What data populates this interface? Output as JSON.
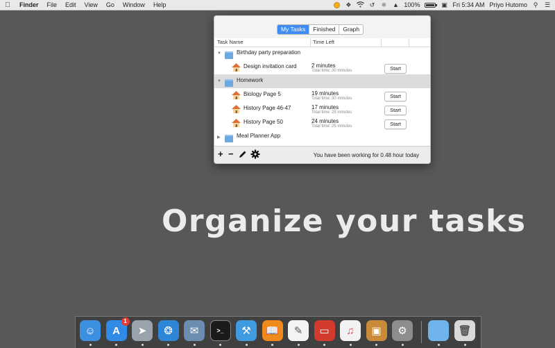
{
  "menubar": {
    "app_name": "Finder",
    "menus": [
      "File",
      "Edit",
      "View",
      "Go",
      "Window",
      "Help"
    ],
    "battery_percent": "100%",
    "battery_level": 1.0,
    "datetime": "Fri 5:34 AM",
    "user": "Priyo Hutomo",
    "tray_icons": [
      "task-timer-icon",
      "dropbox-icon",
      "wifi-icon",
      "time-machine-icon",
      "bluetooth-icon",
      "volume-icon",
      "battery-icon",
      "notification-center-icon",
      "spotlight-icon",
      "menu-list-icon"
    ]
  },
  "popover": {
    "tabs": [
      {
        "label": "My Tasks",
        "active": true
      },
      {
        "label": "Finished",
        "active": false
      },
      {
        "label": "Graph",
        "active": false
      }
    ],
    "columns": {
      "task_name": "Task Name",
      "time_left": "Time Left"
    },
    "rows": [
      {
        "type": "group",
        "name": "Birthday party preparation",
        "expanded": true
      },
      {
        "type": "task",
        "name": "Design invitation card",
        "time_left": "2 minutes",
        "total": "Total time: 30 minutes",
        "button": "Start"
      },
      {
        "type": "group",
        "name": "Homework",
        "expanded": true,
        "selected": true
      },
      {
        "type": "task",
        "name": "Biology Page 5",
        "time_left": "19 minutes",
        "total": "Total time: 30 minutes",
        "button": "Start"
      },
      {
        "type": "task",
        "name": "History Page 46-47",
        "time_left": "17 minutes",
        "total": "Total time: 25 minutes",
        "button": "Start"
      },
      {
        "type": "task",
        "name": "History Page 50",
        "time_left": "24 minutes",
        "total": "Total time: 25 minutes",
        "button": "Start"
      },
      {
        "type": "group",
        "name": "Meal Planner App",
        "expanded": false
      }
    ],
    "footer": {
      "add": "+",
      "remove": "−",
      "edit_icon": "pencil-icon",
      "settings_icon": "gear-icon",
      "status": "You have been working for 0.48 hour today"
    }
  },
  "headline": "Organize your tasks",
  "dock": {
    "apps": [
      {
        "name": "finder",
        "color": "#3d8fe0"
      },
      {
        "name": "app-store",
        "color": "#2f8be6",
        "badge": "1"
      },
      {
        "name": "launchpad",
        "color": "#9aa3ad"
      },
      {
        "name": "safari",
        "color": "#2e86d8"
      },
      {
        "name": "mail-stamp",
        "color": "#6c8db0"
      },
      {
        "name": "terminal",
        "color": "#1b1b1b"
      },
      {
        "name": "xcode",
        "color": "#3f9ae0"
      },
      {
        "name": "ibooks",
        "color": "#f08a1c"
      },
      {
        "name": "textedit",
        "color": "#f4f4f4"
      },
      {
        "name": "parallels",
        "color": "#d43b2f"
      },
      {
        "name": "itunes",
        "color": "#f2f2f2"
      },
      {
        "name": "preview",
        "color": "#c98b3a"
      },
      {
        "name": "system-preferences",
        "color": "#8d8d8d"
      },
      {
        "name": "downloads-folder",
        "color": "#6fb4ec"
      },
      {
        "name": "trash",
        "color": "#d9d9d9"
      }
    ]
  }
}
